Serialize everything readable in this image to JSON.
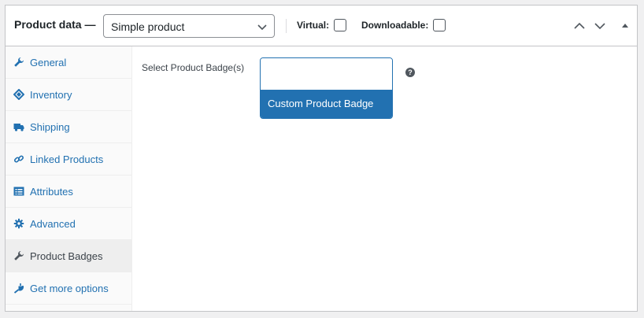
{
  "header": {
    "title": "Product data —",
    "product_type": "Simple product",
    "virtual_label": "Virtual:",
    "downloadable_label": "Downloadable:"
  },
  "tabs": [
    {
      "label": "General",
      "icon": "wrench-icon"
    },
    {
      "label": "Inventory",
      "icon": "tag-icon"
    },
    {
      "label": "Shipping",
      "icon": "truck-icon"
    },
    {
      "label": "Linked Products",
      "icon": "link-icon"
    },
    {
      "label": "Attributes",
      "icon": "list-icon"
    },
    {
      "label": "Advanced",
      "icon": "gear-icon"
    },
    {
      "label": "Product Badges",
      "icon": "wrench-icon",
      "active": true
    },
    {
      "label": "Get more options",
      "icon": "plugin-icon"
    }
  ],
  "content": {
    "field_label": "Select Product Badge(s)",
    "badge_option": "Custom Product Badge",
    "help_glyph": "?"
  },
  "colors": {
    "link": "#2271b1",
    "selected_option_bg": "#2271b1"
  }
}
